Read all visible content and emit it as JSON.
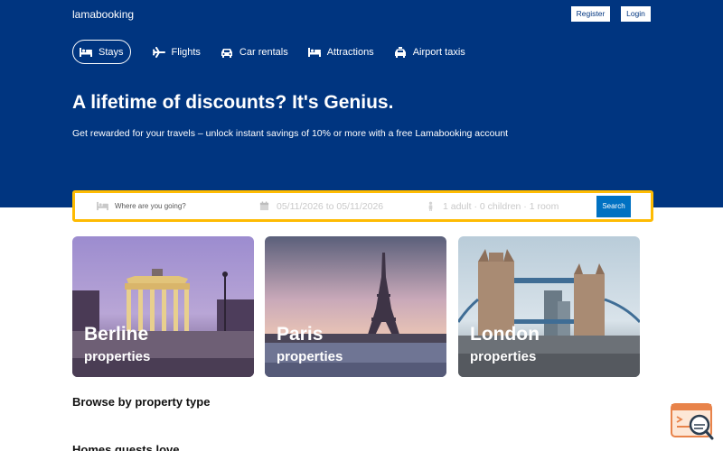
{
  "header": {
    "logo": "lamabooking",
    "register_label": "Register",
    "login_label": "Login"
  },
  "nav": {
    "tabs": [
      {
        "label": "Stays",
        "icon": "bed-icon",
        "active": true
      },
      {
        "label": "Flights",
        "icon": "plane-icon",
        "active": false
      },
      {
        "label": "Car rentals",
        "icon": "car-icon",
        "active": false
      },
      {
        "label": "Attractions",
        "icon": "bed-icon",
        "active": false
      },
      {
        "label": "Airport taxis",
        "icon": "taxi-icon",
        "active": false
      }
    ]
  },
  "hero": {
    "headline": "A lifetime of discounts? It's Genius.",
    "subline": "Get rewarded for your travels – unlock instant savings of 10% or more with a free Lamabooking account"
  },
  "search": {
    "destination_placeholder": "Where are you going?",
    "dates": "05/11/2026 to 05/11/2026",
    "guests": "1 adult · 0 children · 1 room",
    "button_label": "Search"
  },
  "featured": [
    {
      "city": "Berline",
      "caption": "properties"
    },
    {
      "city": "Paris",
      "caption": "properties"
    },
    {
      "city": "London",
      "caption": "properties"
    }
  ],
  "sections": {
    "browse_title": "Browse by property type",
    "homes_title": "Homes guests love"
  },
  "colors": {
    "brand_blue": "#003580",
    "search_border": "#febb02",
    "button_blue": "#0071c2"
  }
}
